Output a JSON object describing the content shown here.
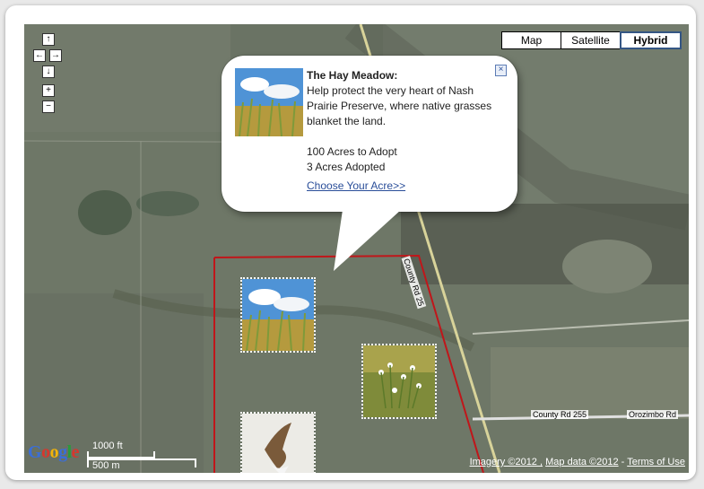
{
  "map_type_buttons": [
    "Map",
    "Satellite",
    "Hybrid"
  ],
  "active_map_type": "Hybrid",
  "nav_controls": {
    "up": "↑",
    "left": "←",
    "right": "→",
    "down": "↓",
    "zoom_in": "+",
    "zoom_out": "−"
  },
  "popup": {
    "title": "The Hay Meadow:",
    "description": "Help protect the very heart of Nash Prairie Preserve, where native grasses blanket the land.",
    "acres_to_adopt": "100 Acres to Adopt",
    "acres_adopted": "3 Acres Adopted",
    "link_text": "Choose Your Acre>>"
  },
  "road_labels": {
    "county_rd_255": "County Rd 255",
    "orozimbo": "Orozimbo Rd",
    "county_rd_25": "County Rd 25"
  },
  "scale": {
    "feet": "1000 ft",
    "meters": "500 m"
  },
  "logo_text": "Google",
  "copyright": {
    "imagery": "Imagery ©2012 ,",
    "map_data": "Map data ©2012",
    "separator": "-",
    "terms": "Terms of Use"
  },
  "colors": {
    "boundary": "#c0161a",
    "accent": "#345684",
    "link": "#2a4e99"
  }
}
